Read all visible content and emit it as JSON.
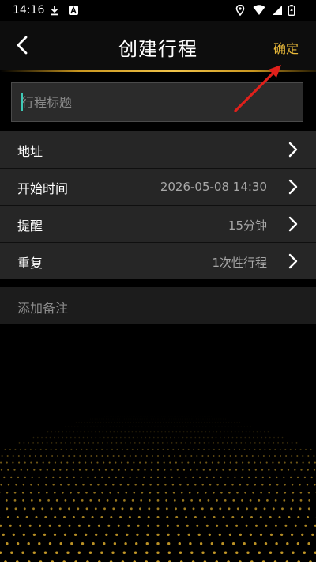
{
  "status_bar": {
    "time": "14:16",
    "icons": [
      "download-icon",
      "app-icon",
      "location-icon",
      "wifi-icon",
      "battery-icon"
    ]
  },
  "header": {
    "title": "创建行程",
    "confirm_label": "确定",
    "back_icon": "chevron-left-icon"
  },
  "title_input": {
    "placeholder": "行程标题",
    "value": ""
  },
  "form_rows": [
    {
      "label": "地址",
      "value": ""
    },
    {
      "label": "开始时间",
      "value": "2026-05-08 14:30"
    },
    {
      "label": "提醒",
      "value": "15分钟"
    },
    {
      "label": "重复",
      "value": "1次性行程"
    }
  ],
  "note": {
    "label": "添加备注"
  },
  "colors": {
    "accent_gold": "#e8b93a",
    "annotation_red": "#e0201b",
    "row_bg": "#262626"
  }
}
